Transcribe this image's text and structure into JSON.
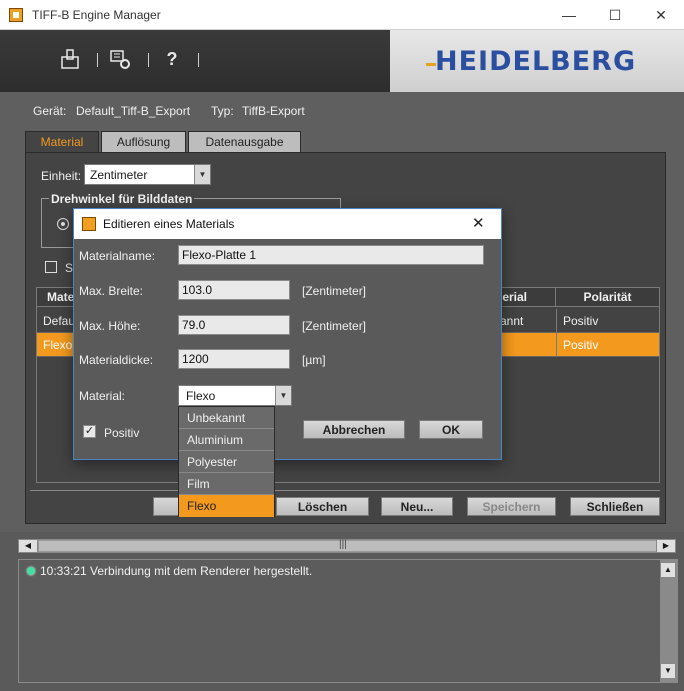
{
  "window": {
    "title": "TIFF-B Engine Manager",
    "minimize": "—",
    "maximize": "☐",
    "close": "✕"
  },
  "brand": {
    "logo": "HEIDELBERG"
  },
  "toolbar": {
    "help": "?"
  },
  "device": {
    "geraet_label": "Gerät:",
    "geraet_value": "Default_Tiff-B_Export",
    "typ_label": "Typ:",
    "typ_value": "TiffB-Export"
  },
  "tabs": [
    {
      "label": "Material",
      "active": true
    },
    {
      "label": "Auflösung",
      "active": false
    },
    {
      "label": "Datenausgabe",
      "active": false
    }
  ],
  "einheit": {
    "label": "Einheit:",
    "value": "Zentimeter"
  },
  "rotation_group": {
    "label": "Drehwinkel für Bilddaten"
  },
  "checkbox_s": {
    "label": "S"
  },
  "table": {
    "headers": [
      "Mate",
      "erial",
      "Polarität"
    ],
    "rows": [
      {
        "name": "Defau",
        "material": "annt",
        "polarity": "Positiv",
        "selected": false
      },
      {
        "name": "Flexo",
        "material": "",
        "polarity": "Positiv",
        "selected": true
      }
    ]
  },
  "buttons": {
    "edit": "B",
    "delete": "Löschen",
    "new": "Neu...",
    "save": "Speichern",
    "close": "Schließen"
  },
  "scroll": {
    "grip": "|||"
  },
  "log": {
    "entries": [
      "10:33:21 Verbindung mit dem Renderer hergestellt."
    ]
  },
  "dialog": {
    "title": "Editieren eines Materials",
    "close": "✕",
    "materialname_label": "Materialname:",
    "materialname_value": "Flexo-Platte 1",
    "max_breite_label": "Max. Breite:",
    "max_breite_value": "103.0",
    "max_breite_unit": "[Zentimeter]",
    "max_hoehe_label": "Max. Höhe:",
    "max_hoehe_value": "79.0",
    "max_hoehe_unit": "[Zentimeter]",
    "materialdicke_label": "Materialdicke:",
    "materialdicke_value": "1200",
    "materialdicke_unit": "[µm]",
    "material_label": "Material:",
    "material_value": "Flexo",
    "positiv_label": "Positiv",
    "positiv_checked": true,
    "cancel": "Abbrechen",
    "ok": "OK",
    "material_options": [
      "Unbekannt",
      "Aluminium",
      "Polyester",
      "Film",
      "Flexo"
    ],
    "material_selected": "Flexo"
  },
  "colors": {
    "accent": "#f39a1e",
    "accent_text": "#f39a1e",
    "brand_blue": "#2a4fa0"
  }
}
